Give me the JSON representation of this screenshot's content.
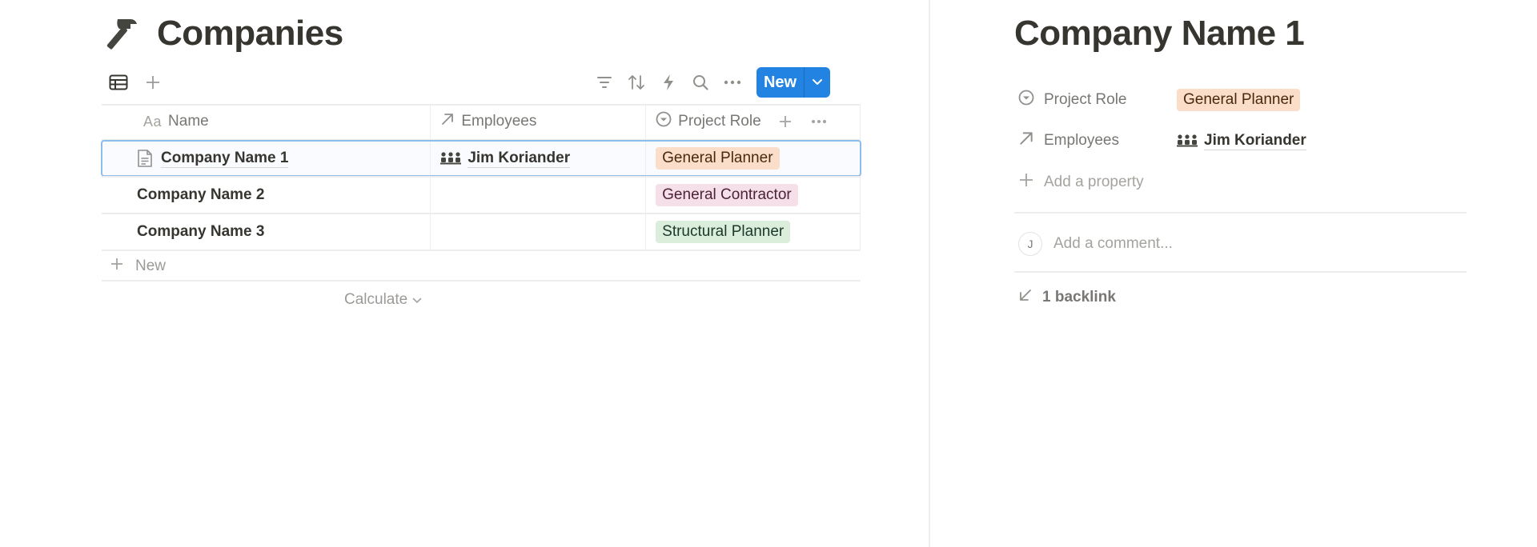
{
  "database": {
    "title": "Companies",
    "title_icon": "hammer-icon",
    "view_icon": "table-icon"
  },
  "toolbar": {
    "filter_icon": "filter-icon",
    "sort_icon": "sort-icon",
    "automation_icon": "lightning-icon",
    "search_icon": "search-icon",
    "more_icon": "more-icon",
    "new_label": "New",
    "new_color": "#2383e2"
  },
  "table": {
    "columns": [
      {
        "label": "Name",
        "prefix": "Aa"
      },
      {
        "label": "Employees"
      },
      {
        "label": "Project Role"
      }
    ],
    "rows": [
      {
        "name": "Company Name 1",
        "employee": "Jim Koriander",
        "role": "General Planner",
        "role_color": "#fadec9",
        "selected": true
      },
      {
        "name": "Company Name 2",
        "employee": "",
        "role": "General Contractor",
        "role_color": "#f5e0e9"
      },
      {
        "name": "Company Name 3",
        "employee": "",
        "role": "Structural Planner",
        "role_color": "#dbeddb"
      }
    ],
    "new_row_label": "New",
    "calculate_label": "Calculate"
  },
  "detail": {
    "title": "Company Name 1",
    "properties": [
      {
        "label": "Project Role",
        "value": "General Planner"
      },
      {
        "label": "Employees",
        "value": "Jim Koriander"
      }
    ],
    "add_property_label": "Add a property",
    "comment_avatar": "J",
    "comment_placeholder": "Add a comment...",
    "backlinks_label": "1 backlink"
  }
}
